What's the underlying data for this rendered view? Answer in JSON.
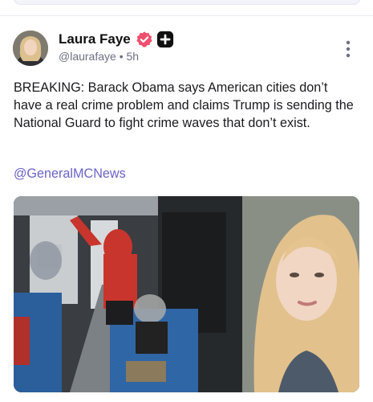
{
  "post": {
    "author": {
      "name": "Laura Faye",
      "handle": "@laurafaye",
      "time": "5h",
      "separator": "•"
    },
    "text": "BREAKING: Barack Obama says American cities don’t have a real crime problem and claims Trump is sending the National Guard to fight crime waves that don’t exist.",
    "mention": "@GeneralMCNews"
  },
  "colors": {
    "verified_badge": "#f0506e",
    "plus_badge": "#111111",
    "link": "#6a63c7",
    "jacket": "#c8352d"
  },
  "icons": {
    "verified": "verified-badge-icon",
    "plus": "plus-badge-icon",
    "more": "more-vertical-icon"
  }
}
